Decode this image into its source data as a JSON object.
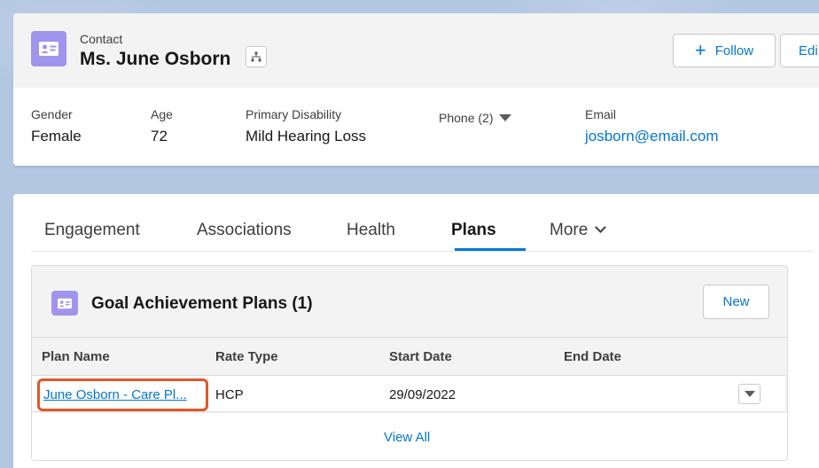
{
  "header": {
    "entity_label": "Contact",
    "title": "Ms. June Osborn",
    "follow_label": "Follow",
    "edit_label": "Edi"
  },
  "fields": {
    "gender": {
      "label": "Gender",
      "value": "Female"
    },
    "age": {
      "label": "Age",
      "value": "72"
    },
    "disability": {
      "label": "Primary Disability",
      "value": "Mild Hearing Loss"
    },
    "phone": {
      "label": "Phone (2)"
    },
    "email": {
      "label": "Email",
      "value": "josborn@email.com"
    }
  },
  "tabs": [
    {
      "label": "Engagement"
    },
    {
      "label": "Associations"
    },
    {
      "label": "Health"
    },
    {
      "label": "Plans",
      "active": true
    },
    {
      "label": "More"
    }
  ],
  "related_list": {
    "title": "Goal Achievement Plans (1)",
    "new_label": "New",
    "columns": [
      "Plan Name",
      "Rate Type",
      "Start Date",
      "End Date"
    ],
    "rows": [
      {
        "plan_name": "June Osborn - Care Pl...",
        "rate_type": "HCP",
        "start_date": "29/09/2022",
        "end_date": ""
      }
    ],
    "view_all_label": "View All"
  },
  "colors": {
    "brand": "#0176d3",
    "icon_bg": "#a094ed",
    "highlight": "#e0572b"
  }
}
